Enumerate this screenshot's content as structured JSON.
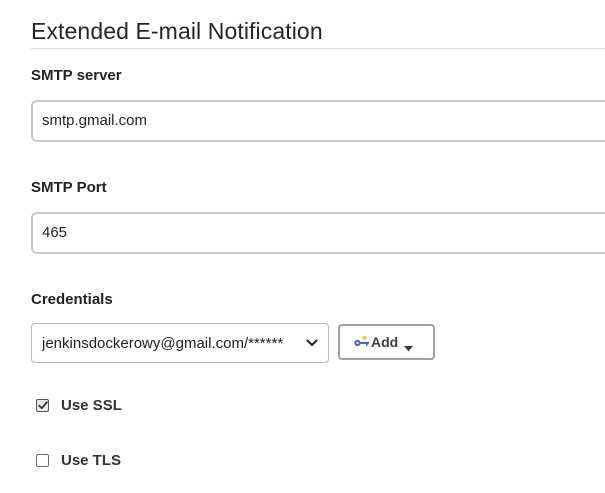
{
  "section": {
    "title": "Extended E-mail Notification"
  },
  "smtp_server": {
    "label": "SMTP server",
    "value": "smtp.gmail.com"
  },
  "smtp_port": {
    "label": "SMTP Port",
    "value": "465"
  },
  "credentials": {
    "label": "Credentials",
    "selected": "jenkinsdockerowy@gmail.com/******",
    "add_button_label": "Add",
    "add_button_icon": "key-icon"
  },
  "options": {
    "use_ssl": {
      "label": "Use SSL",
      "checked": true
    },
    "use_tls": {
      "label": "Use TLS",
      "checked": false
    }
  }
}
